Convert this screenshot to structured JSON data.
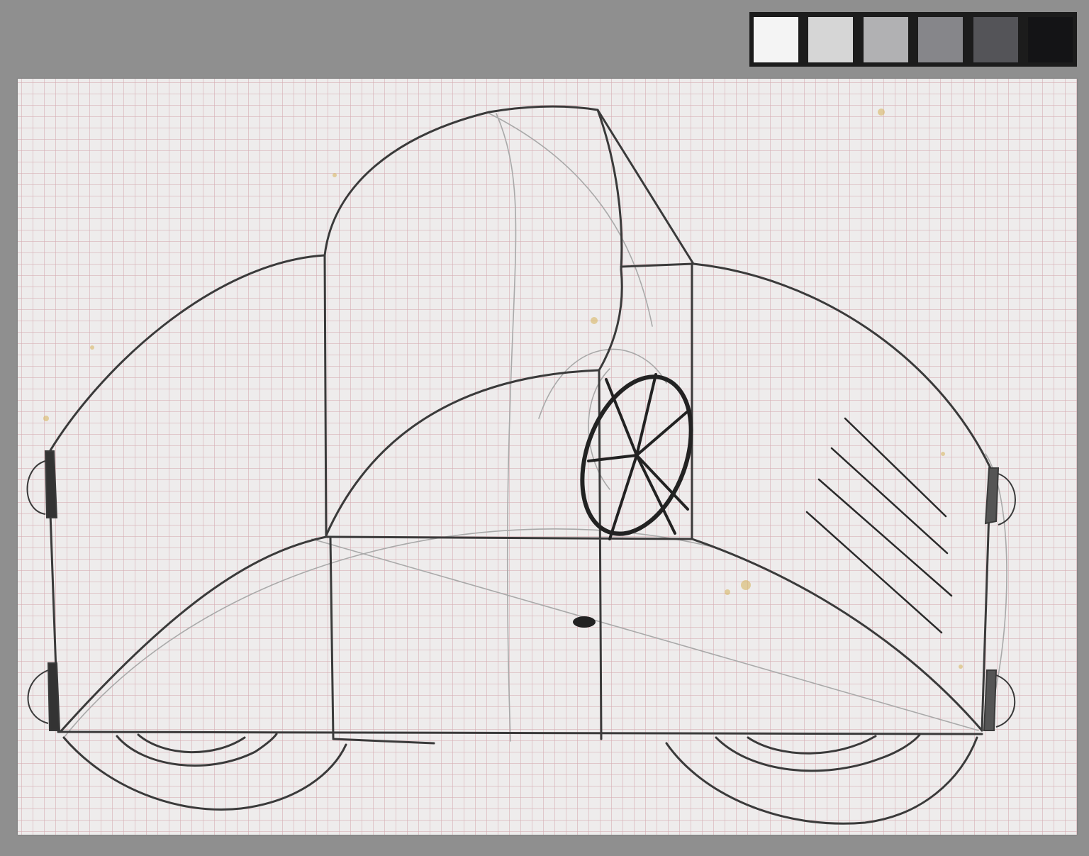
{
  "color_chart": {
    "swatches": [
      "#f4f4f4",
      "#d6d6d6",
      "#b1b1b3",
      "#86868a",
      "#545458",
      "#141416"
    ]
  },
  "paper": {
    "color": "#eeecec",
    "grid_color": "#d6aab0",
    "grid": true
  },
  "drawing": {
    "subject": "car-sketch",
    "medium": "pencil",
    "stroke_color": "#3a3a3a",
    "light_stroke_color": "#a9a9a9",
    "stain_color": "#d8b766"
  }
}
